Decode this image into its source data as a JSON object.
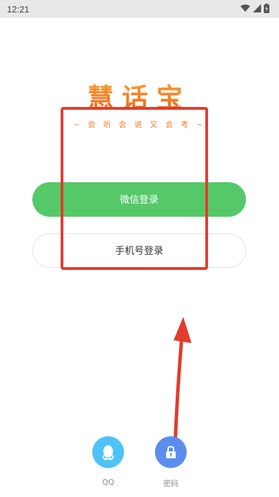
{
  "status_bar": {
    "time": "12:21"
  },
  "brand": {
    "logo_text": "慧话宝",
    "tagline": "~ 会 听 会 说 又 会 考 ~"
  },
  "login": {
    "wechat_label": "微信登录",
    "phone_label": "手机号登录"
  },
  "alt_login": {
    "qq_label": "QQ",
    "password_label": "密码"
  },
  "colors": {
    "accent_green": "#55c868",
    "brand_orange": "#f07a1e",
    "annotation_red": "#e23c2c",
    "qq_blue": "#4fc3f7",
    "password_blue": "#5b8def"
  }
}
